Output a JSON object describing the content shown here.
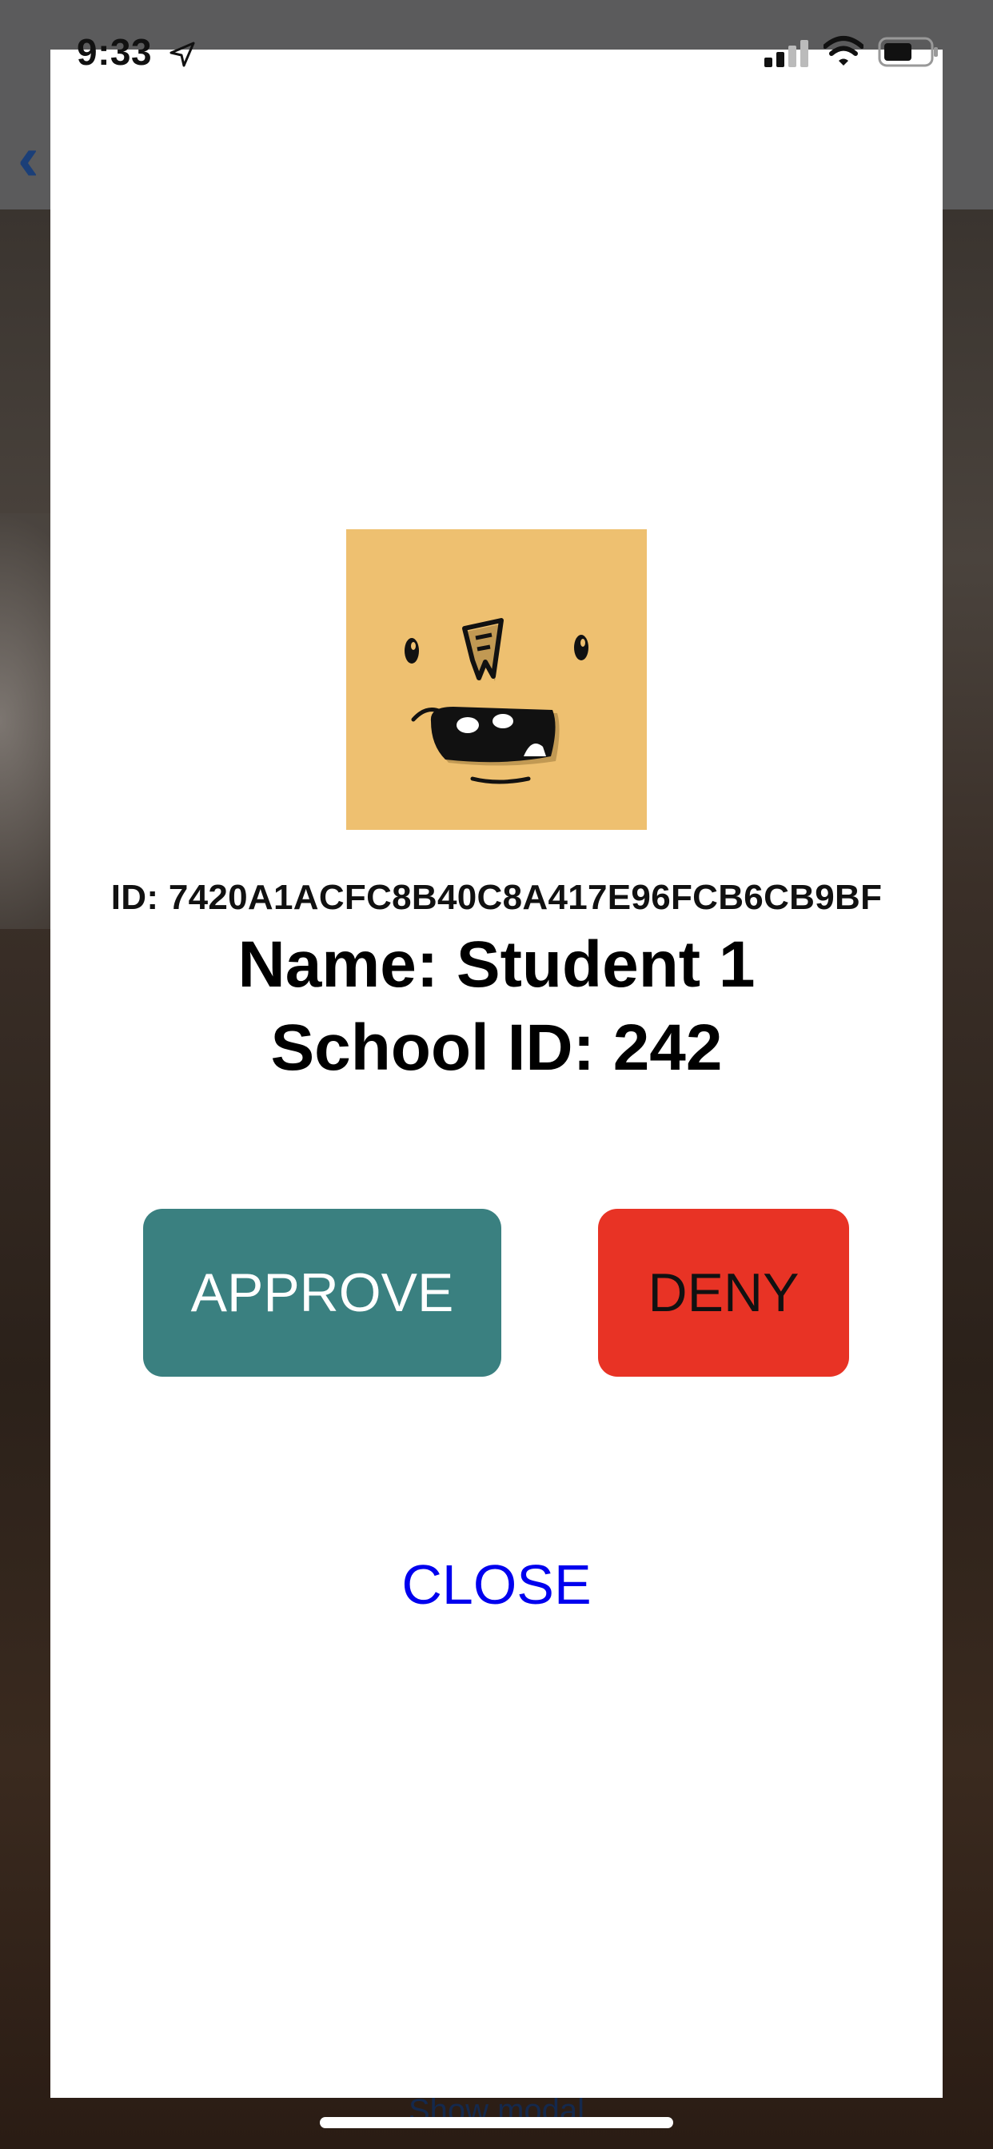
{
  "status_bar": {
    "time": "9:33",
    "icons": [
      "location-arrow-icon",
      "cellular-signal-icon",
      "wifi-icon",
      "battery-icon"
    ]
  },
  "background": {
    "back_icon": "chevron-left-icon",
    "show_modal_label": "Show modal"
  },
  "modal": {
    "avatar_icon": "monster-face-avatar",
    "avatar_color": "#EEC070",
    "id_text": "ID: 7420A1ACFC8B40C8A417E96FCB6CB9BF",
    "name_text": "Name: Student 1",
    "school_id_text": "School ID: 242",
    "approve_label": "APPROVE",
    "deny_label": "DENY",
    "close_label": "CLOSE",
    "colors": {
      "approve": "#3A8080",
      "deny": "#E83325",
      "close": "#0000EE"
    }
  }
}
